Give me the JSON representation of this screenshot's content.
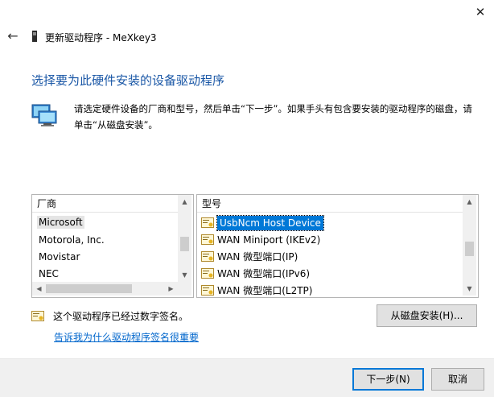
{
  "window": {
    "title": "更新驱动程序 - MeXkey3",
    "close_glyph": "✕",
    "back_glyph": "←"
  },
  "main": {
    "heading": "选择要为此硬件安装的设备驱动程序",
    "description": "请选定硬件设备的厂商和型号，然后单击“下一步”。如果手头有包含要安装的驱动程序的磁盘，请单击“从磁盘安装”。"
  },
  "manufacturer_list": {
    "header": "厂商",
    "items": [
      "Microsoft",
      "Motorola, Inc.",
      "Movistar",
      "NEC"
    ],
    "selected": "Microsoft"
  },
  "model_list": {
    "header": "型号",
    "items": [
      "UsbNcm Host Device",
      "WAN Miniport (IKEv2)",
      "WAN 微型端口(IP)",
      "WAN 微型端口(IPv6)",
      "WAN 微型端口(L2TP)"
    ],
    "selected": "UsbNcm Host Device",
    "item_icon": "driver-certificate-icon"
  },
  "signature": {
    "text": "这个驱动程序已经过数字签名。",
    "link": "告诉我为什么驱动程序签名很重要"
  },
  "buttons": {
    "have_disk": "从磁盘安装(H)...",
    "next": "下一步(N)",
    "cancel": "取消"
  },
  "colors": {
    "heading": "#1a57a6",
    "selection": "#0078d7",
    "link": "#0066cc"
  }
}
